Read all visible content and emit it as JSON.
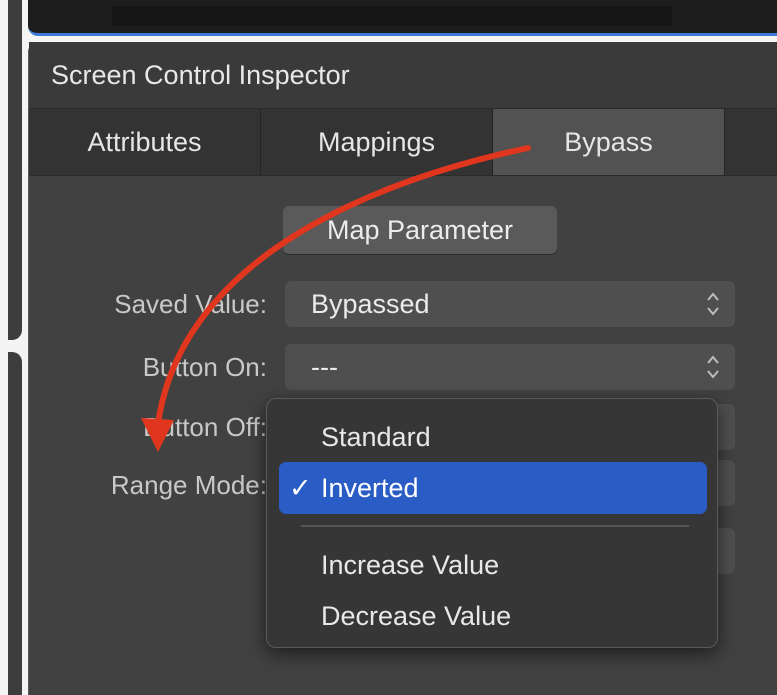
{
  "inspector": {
    "title": "Screen Control Inspector",
    "tabs": [
      {
        "label": "Attributes"
      },
      {
        "label": "Mappings"
      },
      {
        "label": "Bypass"
      }
    ],
    "active_tab": "Bypass",
    "map_parameter_label": "Map Parameter",
    "fields": {
      "saved_value": {
        "label": "Saved Value:",
        "value": "Bypassed"
      },
      "button_on": {
        "label": "Button On:",
        "value": "---"
      },
      "button_off": {
        "label": "Button Off:"
      },
      "range_mode": {
        "label": "Range Mode:"
      }
    }
  },
  "range_menu": {
    "items": [
      {
        "label": "Standard",
        "selected": false
      },
      {
        "label": "Inverted",
        "selected": true
      },
      {
        "label": "Increase Value",
        "selected": false
      },
      {
        "label": "Decrease Value",
        "selected": false
      }
    ],
    "check_glyph": "✓"
  },
  "colors": {
    "annotation_arrow": "#e0361e",
    "selection": "#2a5cc6"
  },
  "icons": {
    "select_stepper": "updown-chevron-icon",
    "check": "checkmark-icon"
  }
}
